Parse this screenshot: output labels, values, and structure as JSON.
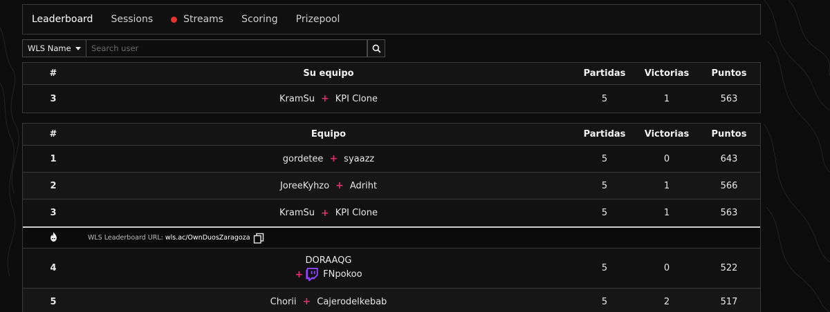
{
  "colors": {
    "live_dot": "#e3312c",
    "plus": "#e0306f",
    "twitch": "#9146ff"
  },
  "nav": {
    "items": [
      {
        "label": "Leaderboard",
        "active": true
      },
      {
        "label": "Sessions"
      },
      {
        "label": "Streams",
        "live": true
      },
      {
        "label": "Scoring"
      },
      {
        "label": "Prizepool"
      }
    ]
  },
  "search": {
    "select_value": "WLS Name",
    "placeholder": "Search user",
    "button_icon": "search-icon"
  },
  "my_team_table": {
    "headers": {
      "rank": "#",
      "team": "Su equipo",
      "matches": "Partidas",
      "wins": "Victorias",
      "points": "Puntos"
    },
    "row": {
      "rank": "3",
      "player1": "KramSu",
      "player2": "KPI Clone",
      "matches": "5",
      "wins": "1",
      "points": "563"
    }
  },
  "leaderboard_table": {
    "headers": {
      "rank": "#",
      "team": "Equipo",
      "matches": "Partidas",
      "wins": "Victorias",
      "points": "Puntos"
    },
    "rows": [
      {
        "rank": "1",
        "player1": "gordetee",
        "player2": "syaazz",
        "matches": "5",
        "wins": "0",
        "points": "643"
      },
      {
        "rank": "2",
        "player1": "JoreeKyhzo",
        "player2": "Adriht",
        "matches": "5",
        "wins": "1",
        "points": "566"
      },
      {
        "rank": "3",
        "player1": "KramSu",
        "player2": "KPI Clone",
        "matches": "5",
        "wins": "1",
        "points": "563"
      },
      {
        "rank": "4",
        "player1": "DORAAQG",
        "player2": "FNpokoo",
        "player2_icon": "twitch-icon",
        "matches": "5",
        "wins": "0",
        "points": "522"
      },
      {
        "rank": "5",
        "player1": "Chorii",
        "player2": "Cajerodelkebab",
        "matches": "5",
        "wins": "2",
        "points": "517"
      }
    ],
    "url_row": {
      "icon": "flame-icon",
      "label": "WLS Leaderboard URL:",
      "url": "wls.ac/OwnDuosZaragoza",
      "copy_icon": "copy-icon"
    }
  }
}
